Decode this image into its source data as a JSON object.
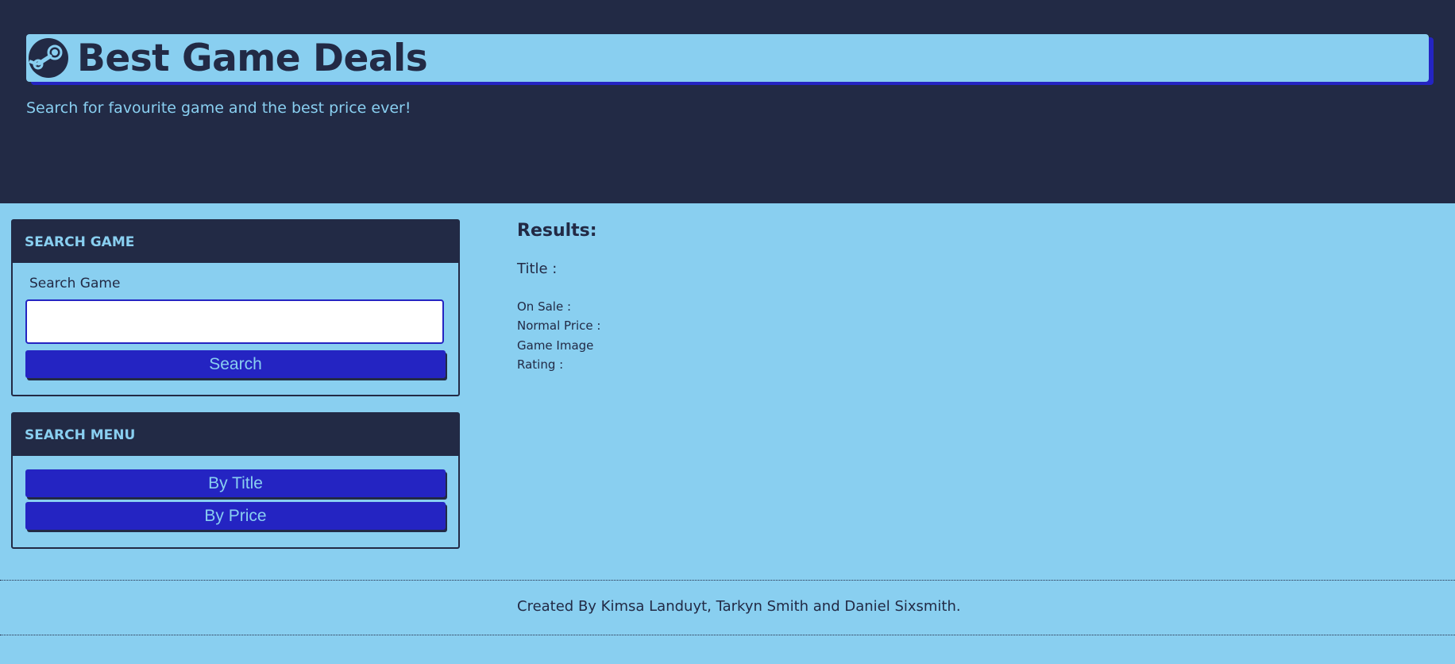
{
  "header": {
    "title": "Best Game Deals",
    "tagline": "Search for favourite game and the best price ever!",
    "logo_icon": "steam-logo-icon"
  },
  "search_panel": {
    "heading": "SEARCH GAME",
    "label": "Search Game",
    "input_value": "",
    "button_label": "Search"
  },
  "menu_panel": {
    "heading": "SEARCH MENU",
    "items": [
      {
        "label": "By Title"
      },
      {
        "label": "By Price"
      }
    ]
  },
  "results": {
    "heading": "Results:",
    "title_label": "Title :",
    "on_sale_label": "On Sale :",
    "normal_price_label": "Normal Price :",
    "image_label": "Game Image",
    "rating_label": "Rating :"
  },
  "footer": {
    "credits": "Created By Kimsa Landuyt, Tarkyn Smith and Daniel Sixsmith."
  },
  "colors": {
    "navy": "#222a45",
    "sky": "#89cff0",
    "button_blue": "#2424c2"
  }
}
